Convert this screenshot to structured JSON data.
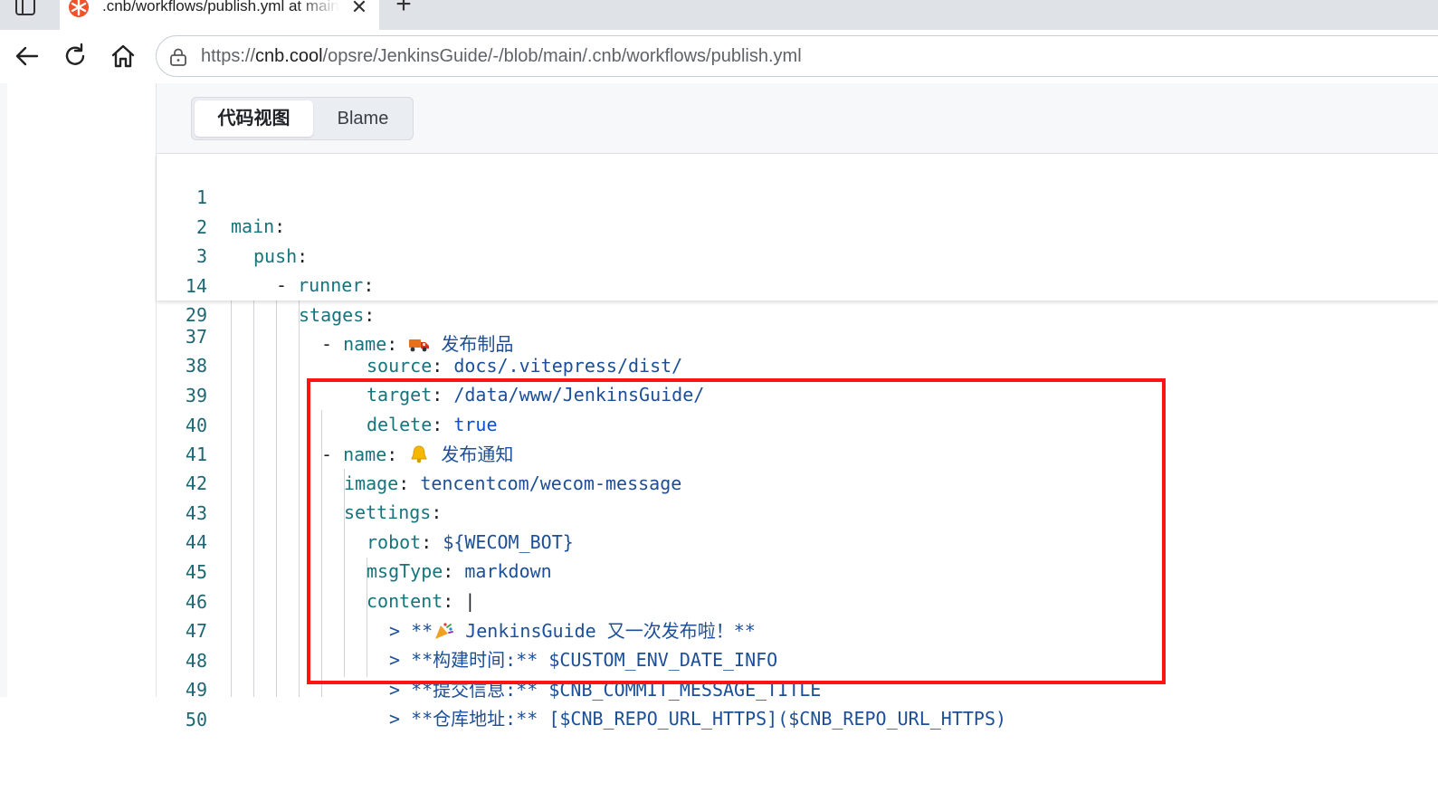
{
  "browser": {
    "tab_title": ".cnb/workflows/publish.yml at main",
    "url_protocol": "https://",
    "url_host": "cnb.cool",
    "url_path": "/opsre/JenkinsGuide/-/blob/main/.cnb/workflows/publish.yml"
  },
  "viewer": {
    "tab_code": "代码视图",
    "tab_blame": "Blame"
  },
  "colors": {
    "highlight_border": "#ff1414",
    "key": "#16747c",
    "value": "#1c4f97",
    "boolean": "#0b4fd2"
  },
  "sticky_lines": [
    {
      "num": "1",
      "key": "main",
      "sep": ":",
      "value": ""
    },
    {
      "num": "2",
      "key": "push",
      "sep": ":",
      "value": ""
    },
    {
      "num": "3",
      "dash": "- ",
      "key": "runner",
      "sep": ":",
      "value": ""
    },
    {
      "num": "14",
      "key": "stages",
      "sep": ":",
      "value": ""
    },
    {
      "num": "29",
      "dash": "- ",
      "key": "name",
      "sep": ": ",
      "emoji": "truck-emoji",
      "value": " 发布制品"
    }
  ],
  "lines": [
    {
      "num": "37",
      "key": "source",
      "sep": ": ",
      "value": "docs/.vitepress/dist/"
    },
    {
      "num": "38",
      "key": "target",
      "sep": ": ",
      "value": "/data/www/JenkinsGuide/"
    },
    {
      "num": "39",
      "key": "delete",
      "sep": ": ",
      "value": "true"
    },
    {
      "num": "40",
      "dash": "- ",
      "key": "name",
      "sep": ": ",
      "emoji": "bell-emoji",
      "value": " 发布通知"
    },
    {
      "num": "41",
      "key": "image",
      "sep": ": ",
      "value": "tencentcom/wecom-message"
    },
    {
      "num": "42",
      "key": "settings",
      "sep": ":",
      "value": ""
    },
    {
      "num": "43",
      "key": "robot",
      "sep": ": ",
      "value": "${WECOM_BOT}"
    },
    {
      "num": "44",
      "key": "msgType",
      "sep": ": ",
      "value": "markdown"
    },
    {
      "num": "45",
      "key": "content",
      "sep": ": ",
      "value": "|"
    },
    {
      "num": "46",
      "value_pre": "> **",
      "emoji": "party-popper-emoji",
      "value": " JenkinsGuide 又一次发布啦！**"
    },
    {
      "num": "47",
      "value": "> **构建时间:** $CUSTOM_ENV_DATE_INFO"
    },
    {
      "num": "48",
      "value": "> **提交信息:** $CNB_COMMIT_MESSAGE_TITLE"
    },
    {
      "num": "49",
      "value": "> **仓库地址:** [$CNB_REPO_URL_HTTPS]($CNB_REPO_URL_HTTPS)"
    },
    {
      "num": "50",
      "value": ""
    }
  ]
}
